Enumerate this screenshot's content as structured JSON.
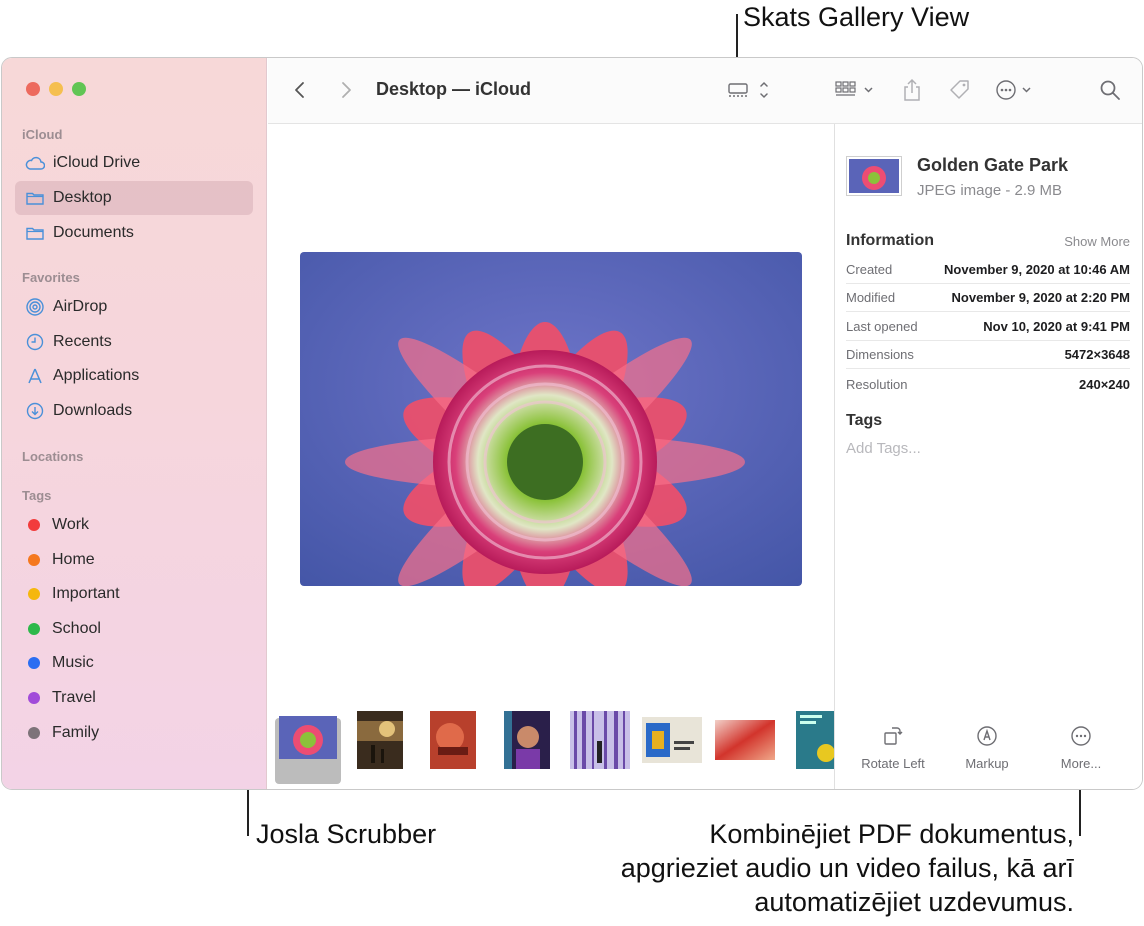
{
  "callouts": {
    "gallery_view": "Skats Gallery View",
    "scrubber": "Josla Scrubber",
    "more_line1": "Kombinējiet PDF dokumentus,",
    "more_line2": "apgrieziet audio un video failus, kā arī",
    "more_line3": "automatizējiet uzdevumus."
  },
  "window": {
    "title": "Desktop — iCloud"
  },
  "sidebar": {
    "sections": {
      "icloud": "iCloud",
      "favorites": "Favorites",
      "locations": "Locations",
      "tags": "Tags"
    },
    "icloud_items": [
      {
        "label": "iCloud Drive",
        "icon": "cloud-icon"
      },
      {
        "label": "Desktop",
        "icon": "folder-icon",
        "selected": true
      },
      {
        "label": "Documents",
        "icon": "folder-icon"
      }
    ],
    "favorite_items": [
      {
        "label": "AirDrop",
        "icon": "airdrop-icon"
      },
      {
        "label": "Recents",
        "icon": "clock-icon"
      },
      {
        "label": "Applications",
        "icon": "applications-icon"
      },
      {
        "label": "Downloads",
        "icon": "download-icon"
      }
    ],
    "tag_items": [
      {
        "label": "Work",
        "color": "#f23c3c"
      },
      {
        "label": "Home",
        "color": "#f5781e"
      },
      {
        "label": "Important",
        "color": "#f5b70e"
      },
      {
        "label": "School",
        "color": "#2db84a"
      },
      {
        "label": "Music",
        "color": "#2b6ef2"
      },
      {
        "label": "Travel",
        "color": "#a14bd9"
      },
      {
        "label": "Family",
        "color": "#7d7379"
      }
    ]
  },
  "inspector": {
    "file_name": "Golden Gate Park",
    "file_kind": "JPEG image - 2.9 MB",
    "information_heading": "Information",
    "show_more": "Show More",
    "rows": [
      {
        "key": "Created",
        "value": "November 9, 2020 at 10:46 AM"
      },
      {
        "key": "Modified",
        "value": "November 9, 2020 at 2:20 PM"
      },
      {
        "key": "Last opened",
        "value": "Nov 10, 2020 at 9:41 PM"
      },
      {
        "key": "Dimensions",
        "value": "5472×3648"
      },
      {
        "key": "Resolution",
        "value": "240×240"
      }
    ],
    "tags_heading": "Tags",
    "add_tags_placeholder": "Add Tags...",
    "actions": {
      "rotate_left": "Rotate Left",
      "markup": "Markup",
      "more": "More..."
    }
  },
  "colors": {
    "accent_folder": "#4a90d9",
    "sidebar_bg_top": "#f7d8d8"
  }
}
